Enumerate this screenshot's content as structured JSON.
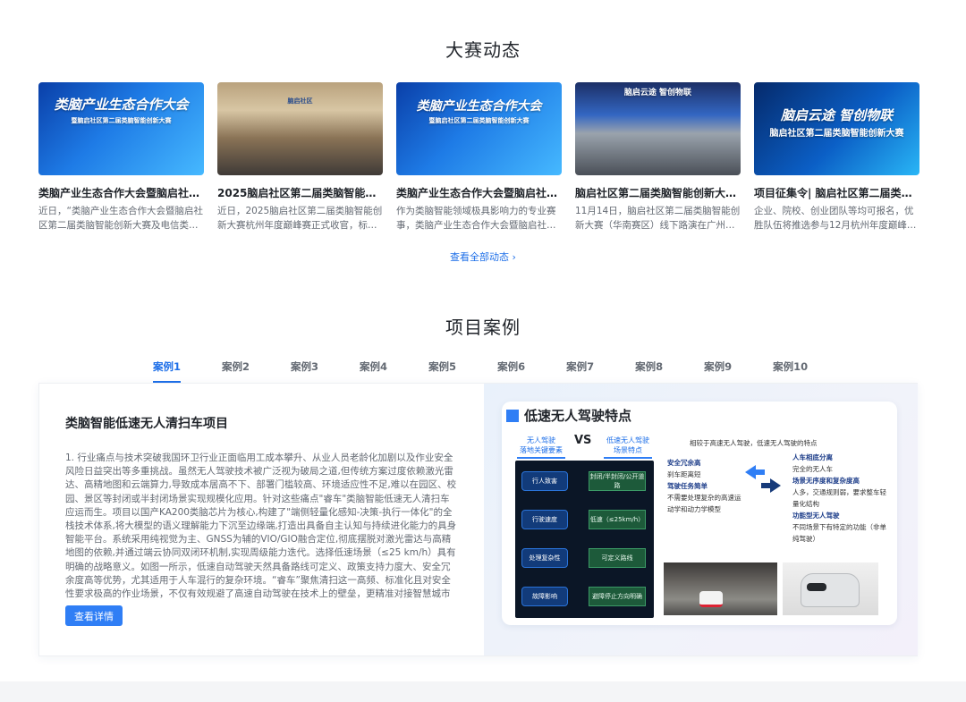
{
  "news_section": {
    "title": "大赛动态",
    "view_all": "查看全部动态 ›",
    "cards": [
      {
        "image_text": "类脑产业生态合作大会",
        "image_sub": "暨脑启社区第二届类脑智能创新大赛",
        "title": "类脑产业生态合作大会暨脑启社区…",
        "desc": "近日，“类脑产业生态合作大会暨脑启社区第二届类脑智能创新大赛及电信类脑…"
      },
      {
        "image_text": "脑启社区",
        "image_sub": "",
        "title": "2025脑启社区第二届类脑智能创…",
        "desc": "近日，2025脑启社区第二届类脑智能创新大赛杭州年度巅峰赛正式收官，标志…"
      },
      {
        "image_text": "类脑产业生态合作大会",
        "image_sub": "暨脑启社区第二届类脑智能创新大赛",
        "title": "类脑产业生态合作大会暨脑启社区…",
        "desc": "作为类脑智能领域极具影响力的专业赛事，类脑产业生态合作大会暨脑启社区…"
      },
      {
        "image_text": "脑启云途 智创物联",
        "image_sub": "",
        "title": "脑启社区第二届类脑智能创新大赛…",
        "desc": "11月14日，脑启社区第二届类脑智能创新大赛（华南赛区）线下路演在广州数…"
      },
      {
        "image_text": "脑启云途 智创物联",
        "image_sub": "脑启社区第二届类脑智能创新大赛",
        "title": "项目征集令| 脑启社区第二届类脑…",
        "desc": "企业、院校、创业团队等均可报名，优胜队伍将推选参与12月杭州年度巅峰赛，…"
      }
    ]
  },
  "case_section": {
    "title": "项目案例",
    "tabs": [
      "案例1",
      "案例2",
      "案例3",
      "案例4",
      "案例5",
      "案例6",
      "案例7",
      "案例8",
      "案例9",
      "案例10"
    ],
    "active_tab": 0,
    "case": {
      "title": "类脑智能低速无人清扫车项目",
      "body": "1. 行业痛点与技术突破我国环卫行业正面临用工成本攀升、从业人员老龄化加剧以及作业安全风险日益突出等多重挑战。虽然无人驾驶技术被广泛视为破局之道,但传统方案过度依赖激光雷达、高精地图和云端算力,导致成本居高不下、部署门槛较高、环境适应性不足,难以在园区、校园、景区等封闭或半封闭场景实现规模化应用。针对这些痛点\"睿车\"类脑智能低速无人清扫车应运而生。项目以国产KA200类脑芯片为核心,构建了\"端侧轻量化感知-决策-执行一体化\"的全栈技术体系,将大模型的语义理解能力下沉至边缘端,打造出具备自主认知与持续进化能力的具身智能平台。系统采用纯视觉为主、GNSS为辅的VIO/GIO融合定位,彻底摆脱对激光雷达与高精地图的依赖,并通过端云协同双闭环机制,实现周级能力迭代。选择低速场景（≤25 km/h）具有明确的战略意义。如图一所示，低速自动驾驶天然具备路线可定义、政策支持力度大、安全冗余度高等优势，尤其适用于人车混行的复杂环境。“睿车”聚焦清扫这一高频、标准化且对安全性要求极高的作业场景，不仅有效规避了高速自动驾驶在技术上的壁垒，更精准对接智慧城市升级所催生的市场机遇，形成清晰且可持续…",
      "button": "查看详情",
      "slide": {
        "title": "低速无人驾驶特点",
        "left_head": "无人驾驶\n落地关键要素",
        "vs": "VS",
        "right_head": "低速无人驾驶\n场景特点",
        "intro": "相较于高速无人驾驶，低速无人驾驶的特点",
        "pills": [
          "行人致害",
          "行驶速度",
          "处理复杂性",
          "故障影响"
        ],
        "green": [
          "封闭/半封闭/公开道路",
          "低速（≤25km/h）",
          "可定义路线",
          "避障停止方向明确"
        ],
        "points_left": [
          {
            "head": "安全冗余高",
            "text": "刹车距离短"
          },
          {
            "head": "驾驶任务简单",
            "text": "不需要处理复杂的高速运动学和动力学模型"
          }
        ],
        "points_right": [
          {
            "head": "人车相底分离",
            "text": "完全的无人车"
          },
          {
            "head": "场景无序度和复杂度高",
            "text": "人多，交通规则弱，要求整车轻量化结构"
          },
          {
            "head": "功能型无人驾驶",
            "text": "不同场景下有特定的功能（非单纯驾驶）"
          }
        ]
      }
    }
  }
}
